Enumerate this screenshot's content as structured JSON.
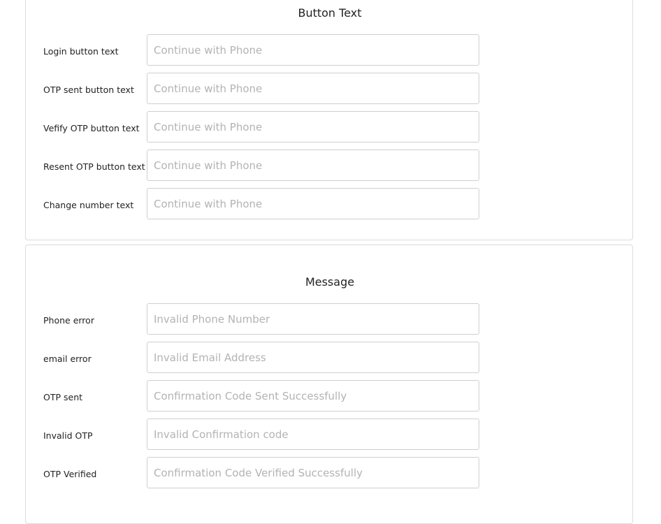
{
  "button_text_section": {
    "title": "Button Text",
    "fields": [
      {
        "label": "Login button text",
        "value": "",
        "placeholder": "Continue with Phone"
      },
      {
        "label": "OTP sent button text",
        "value": "",
        "placeholder": "Continue with Phone"
      },
      {
        "label": "Vefify OTP button text",
        "value": "",
        "placeholder": "Continue with Phone"
      },
      {
        "label": "Resent OTP button text",
        "value": "",
        "placeholder": "Continue with Phone"
      },
      {
        "label": "Change number text",
        "value": "",
        "placeholder": "Continue with Phone"
      }
    ]
  },
  "message_section": {
    "title": "Message",
    "fields": [
      {
        "label": "Phone error",
        "value": "",
        "placeholder": "Invalid Phone Number"
      },
      {
        "label": "email error",
        "value": "",
        "placeholder": "Invalid Email Address"
      },
      {
        "label": "OTP sent",
        "value": "",
        "placeholder": "Confirmation Code Sent Successfully"
      },
      {
        "label": "Invalid OTP",
        "value": "",
        "placeholder": "Invalid Confirmation code"
      },
      {
        "label": "OTP Verified",
        "value": "",
        "placeholder": "Confirmation Code Verified Successfully"
      }
    ]
  }
}
